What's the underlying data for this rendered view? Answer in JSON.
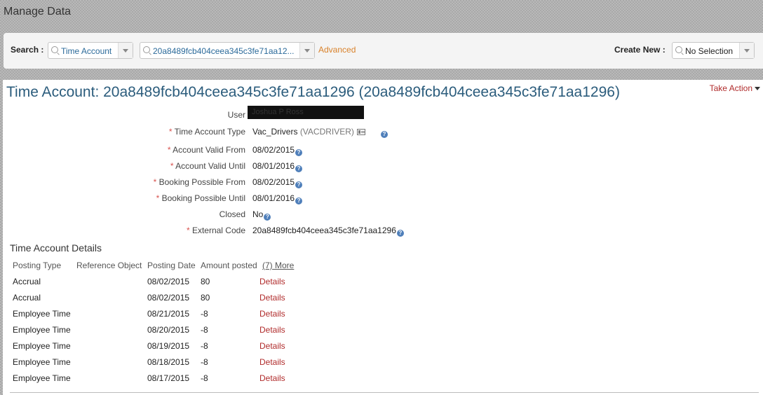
{
  "page_title": "Manage Data",
  "search": {
    "label": "Search :",
    "type_value": "Time Account",
    "record_value": "20a8489fcb404ceea345c3fe71aa12...",
    "advanced_label": "Advanced",
    "create_label": "Create New :",
    "create_value": "No Selection"
  },
  "record": {
    "title": "Time Account: 20a8489fcb404ceea345c3fe71aa1296 (20a8489fcb404ceea345c3fe71aa1296)",
    "take_action": "Take Action",
    "fields": {
      "user_label": "User",
      "user_value": "Joshua P Ross",
      "type_label": "Time Account Type",
      "type_value": "Vac_Drivers",
      "type_code": "(VACDRIVER)",
      "valid_from_label": "Account Valid From",
      "valid_from_value": "08/02/2015",
      "valid_until_label": "Account Valid Until",
      "valid_until_value": "08/01/2016",
      "booking_from_label": "Booking Possible From",
      "booking_from_value": "08/02/2015",
      "booking_until_label": "Booking Possible Until",
      "booking_until_value": "08/01/2016",
      "closed_label": "Closed",
      "closed_value": "No",
      "external_label": "External Code",
      "external_value": "20a8489fcb404ceea345c3fe71aa1296"
    }
  },
  "details": {
    "title": "Time Account Details",
    "columns": {
      "posting_type": "Posting Type",
      "reference_object": "Reference Object",
      "posting_date": "Posting Date",
      "amount_posted": "Amount posted",
      "more": "(7) More"
    },
    "rows": [
      {
        "type": "Accrual",
        "date": "08/02/2015",
        "amount": "80",
        "action": "Details"
      },
      {
        "type": "Accrual",
        "date": "08/02/2015",
        "amount": "80",
        "action": "Details"
      },
      {
        "type": "Employee Time",
        "date": "08/21/2015",
        "amount": "-8",
        "action": "Details"
      },
      {
        "type": "Employee Time",
        "date": "08/20/2015",
        "amount": "-8",
        "action": "Details"
      },
      {
        "type": "Employee Time",
        "date": "08/19/2015",
        "amount": "-8",
        "action": "Details"
      },
      {
        "type": "Employee Time",
        "date": "08/18/2015",
        "amount": "-8",
        "action": "Details"
      },
      {
        "type": "Employee Time",
        "date": "08/17/2015",
        "amount": "-8",
        "action": "Details"
      }
    ]
  }
}
